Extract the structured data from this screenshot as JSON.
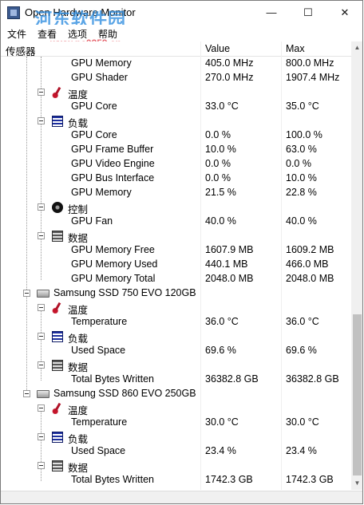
{
  "window": {
    "title": "Open Hardware Monitor",
    "watermark": "河东软件园",
    "watermark_url": "www.pc0359.cn",
    "controls": {
      "minimize": "—",
      "maximize": "☐",
      "close": "✕"
    }
  },
  "menu": [
    "文件",
    "查看",
    "选项",
    "帮助"
  ],
  "columns": {
    "sensor": "传感器",
    "value": "Value",
    "max": "Max"
  },
  "rows": [
    {
      "label": "GPU Memory",
      "value": "405.0 MHz",
      "max": "800.0 MHz"
    },
    {
      "label": "GPU Shader",
      "value": "270.0 MHz",
      "max": "1907.4 MHz"
    },
    {
      "label": "温度",
      "value": "",
      "max": ""
    },
    {
      "label": "GPU Core",
      "value": "33.0 °C",
      "max": "35.0 °C"
    },
    {
      "label": "负载",
      "value": "",
      "max": ""
    },
    {
      "label": "GPU Core",
      "value": "0.0 %",
      "max": "100.0 %"
    },
    {
      "label": "GPU Frame Buffer",
      "value": "10.0 %",
      "max": "63.0 %"
    },
    {
      "label": "GPU Video Engine",
      "value": "0.0 %",
      "max": "0.0 %"
    },
    {
      "label": "GPU Bus Interface",
      "value": "0.0 %",
      "max": "10.0 %"
    },
    {
      "label": "GPU Memory",
      "value": "21.5 %",
      "max": "22.8 %"
    },
    {
      "label": "控制",
      "value": "",
      "max": ""
    },
    {
      "label": "GPU Fan",
      "value": "40.0 %",
      "max": "40.0 %"
    },
    {
      "label": "数据",
      "value": "",
      "max": ""
    },
    {
      "label": "GPU Memory Free",
      "value": "1607.9 MB",
      "max": "1609.2 MB"
    },
    {
      "label": "GPU Memory Used",
      "value": "440.1 MB",
      "max": "466.0 MB"
    },
    {
      "label": "GPU Memory Total",
      "value": "2048.0 MB",
      "max": "2048.0 MB"
    },
    {
      "label": "Samsung SSD 750 EVO 120GB",
      "value": "",
      "max": ""
    },
    {
      "label": "温度",
      "value": "",
      "max": ""
    },
    {
      "label": "Temperature",
      "value": "36.0 °C",
      "max": "36.0 °C"
    },
    {
      "label": "负载",
      "value": "",
      "max": ""
    },
    {
      "label": "Used Space",
      "value": "69.6 %",
      "max": "69.6 %"
    },
    {
      "label": "数据",
      "value": "",
      "max": ""
    },
    {
      "label": "Total Bytes Written",
      "value": "36382.8 GB",
      "max": "36382.8 GB"
    },
    {
      "label": "Samsung SSD 860 EVO 250GB",
      "value": "",
      "max": ""
    },
    {
      "label": "温度",
      "value": "",
      "max": ""
    },
    {
      "label": "Temperature",
      "value": "30.0 °C",
      "max": "30.0 °C"
    },
    {
      "label": "负载",
      "value": "",
      "max": ""
    },
    {
      "label": "Used Space",
      "value": "23.4 %",
      "max": "23.4 %"
    },
    {
      "label": "数据",
      "value": "",
      "max": ""
    },
    {
      "label": "Total Bytes Written",
      "value": "1742.3 GB",
      "max": "1742.3 GB"
    }
  ],
  "icons": {
    "temperature": "thermometer-icon",
    "load": "load-bars-icon",
    "control": "fan-icon",
    "data": "data-icon",
    "drive": "hard-drive-icon"
  },
  "colors": {
    "temp_red": "#b01328",
    "load_blue": "#1d2f9e",
    "watermark_blue": "#2e8de0",
    "watermark_red": "#e2505a"
  }
}
